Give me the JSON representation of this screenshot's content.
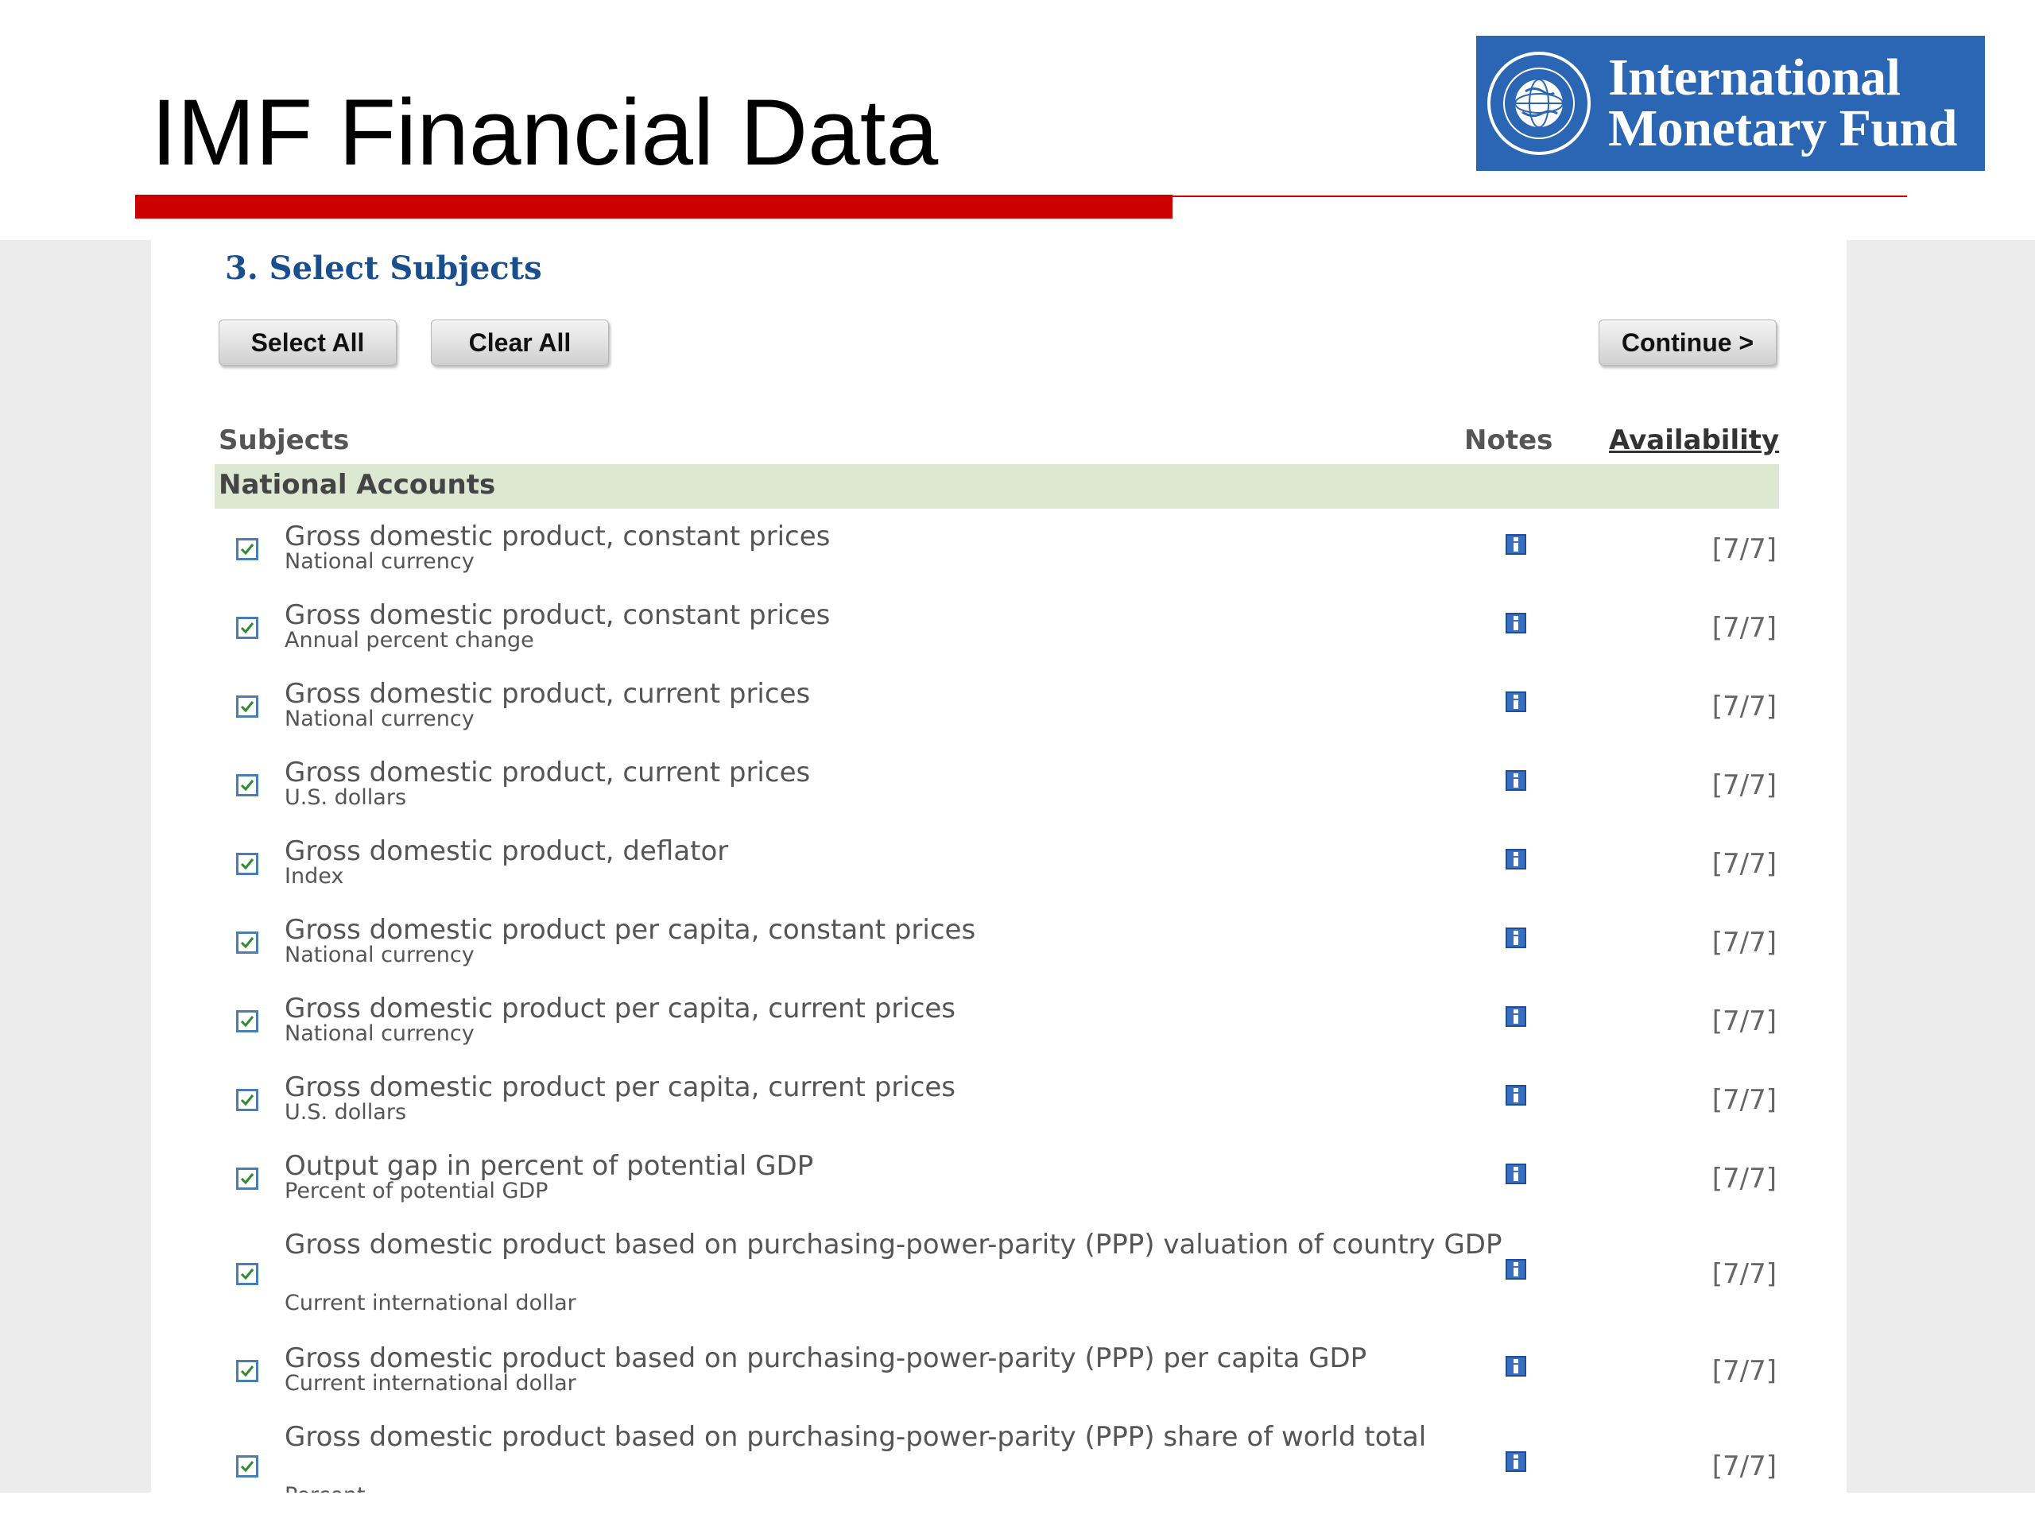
{
  "slide": {
    "title": "IMF Financial Data",
    "logo_line1": "International",
    "logo_line2": "Monetary Fund",
    "seal_text": "INTERNATIONAL MONETARY FUND"
  },
  "colors": {
    "accent_red": "#cc0000",
    "logo_blue": "#2a66b4",
    "section_blue": "#1a4f8f",
    "group_bg": "#dde8d3"
  },
  "section": {
    "title": "3. Select Subjects"
  },
  "buttons": {
    "select_all": "Select All",
    "clear_all": "Clear All",
    "continue": "Continue >"
  },
  "table": {
    "headers": {
      "subjects": "Subjects",
      "notes": "Notes",
      "availability": "Availability"
    },
    "group": "National Accounts",
    "rows": [
      {
        "subject": "Gross domestic product, constant prices",
        "unit": "National currency",
        "checked": true,
        "availability": "[7/7]"
      },
      {
        "subject": "Gross domestic product, constant prices",
        "unit": "Annual percent change",
        "checked": true,
        "availability": "[7/7]"
      },
      {
        "subject": "Gross domestic product, current prices",
        "unit": "National currency",
        "checked": true,
        "availability": "[7/7]"
      },
      {
        "subject": "Gross domestic product, current prices",
        "unit": "U.S. dollars",
        "checked": true,
        "availability": "[7/7]"
      },
      {
        "subject": "Gross domestic product, deflator",
        "unit": "Index",
        "checked": true,
        "availability": "[7/7]"
      },
      {
        "subject": "Gross domestic product per capita, constant prices",
        "unit": "National currency",
        "checked": true,
        "availability": "[7/7]"
      },
      {
        "subject": "Gross domestic product per capita, current prices",
        "unit": "National currency",
        "checked": true,
        "availability": "[7/7]"
      },
      {
        "subject": "Gross domestic product per capita, current prices",
        "unit": "U.S. dollars",
        "checked": true,
        "availability": "[7/7]"
      },
      {
        "subject": "Output gap in percent of potential GDP",
        "unit": "Percent of potential GDP",
        "checked": true,
        "availability": "[7/7]"
      },
      {
        "subject": "Gross domestic product based on purchasing-power-parity (PPP) valuation of country GDP",
        "unit": "Current international dollar",
        "checked": true,
        "availability": "[7/7]"
      },
      {
        "subject": "Gross domestic product based on purchasing-power-parity (PPP) per capita GDP",
        "unit": "Current international dollar",
        "checked": true,
        "availability": "[7/7]"
      },
      {
        "subject": "Gross domestic product based on purchasing-power-parity (PPP) share of world total",
        "unit": "Percent",
        "checked": true,
        "availability": "[7/7]"
      }
    ]
  },
  "icons": {
    "checkbox": "checkbox-checked-icon",
    "notes": "info-icon",
    "seal": "imf-seal-icon"
  }
}
